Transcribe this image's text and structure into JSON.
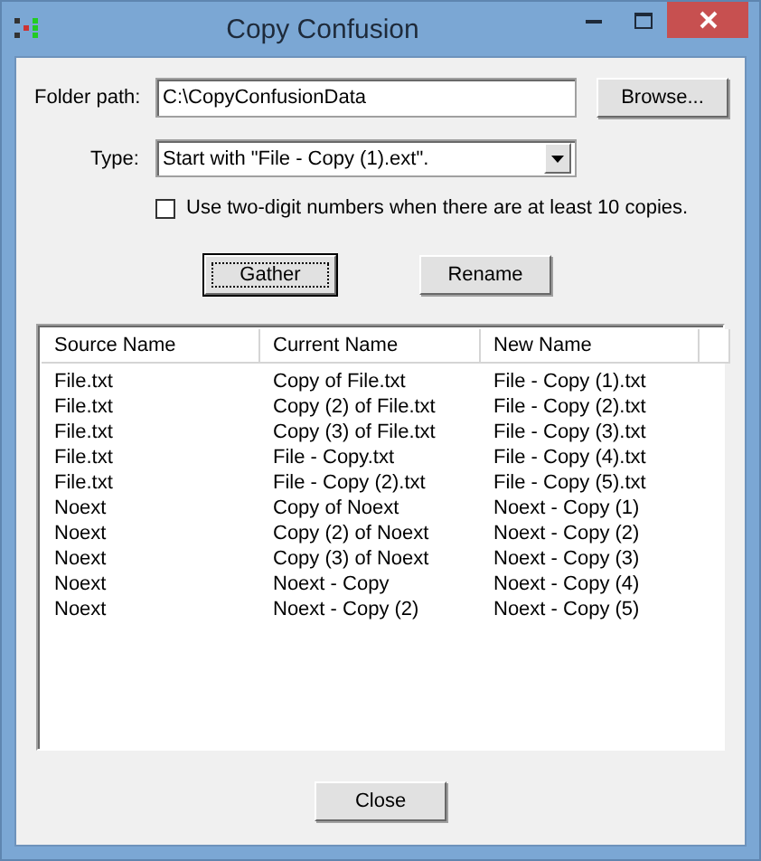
{
  "window": {
    "title": "Copy Confusion"
  },
  "folder_path": {
    "label": "Folder path:",
    "value": "C:\\CopyConfusionData"
  },
  "browse_button": "Browse...",
  "type": {
    "label": "Type:",
    "value": "Start with \"File - Copy (1).ext\"."
  },
  "two_digit": {
    "label": "Use two-digit numbers when there are at least 10 copies.",
    "checked": false
  },
  "buttons": [
    {
      "label": "Gather",
      "focused": true
    },
    {
      "label": "Rename",
      "focused": false
    }
  ],
  "table": {
    "columns": [
      "Source Name",
      "Current Name",
      "New Name"
    ],
    "rows": [
      [
        "File.txt",
        "Copy of File.txt",
        "File - Copy (1).txt"
      ],
      [
        "File.txt",
        "Copy (2) of File.txt",
        "File - Copy (2).txt"
      ],
      [
        "File.txt",
        "Copy (3) of File.txt",
        "File - Copy (3).txt"
      ],
      [
        "File.txt",
        "File - Copy.txt",
        "File - Copy (4).txt"
      ],
      [
        "File.txt",
        "File - Copy (2).txt",
        "File - Copy (5).txt"
      ],
      [
        "Noext",
        "Copy of Noext",
        "Noext - Copy (1)"
      ],
      [
        "Noext",
        "Copy (2) of Noext",
        "Noext - Copy (2)"
      ],
      [
        "Noext",
        "Copy (3) of Noext",
        "Noext - Copy (3)"
      ],
      [
        "Noext",
        "Noext - Copy",
        "Noext - Copy (4)"
      ],
      [
        "Noext",
        "Noext - Copy (2)",
        "Noext - Copy (5)"
      ]
    ]
  },
  "close_button": "Close"
}
